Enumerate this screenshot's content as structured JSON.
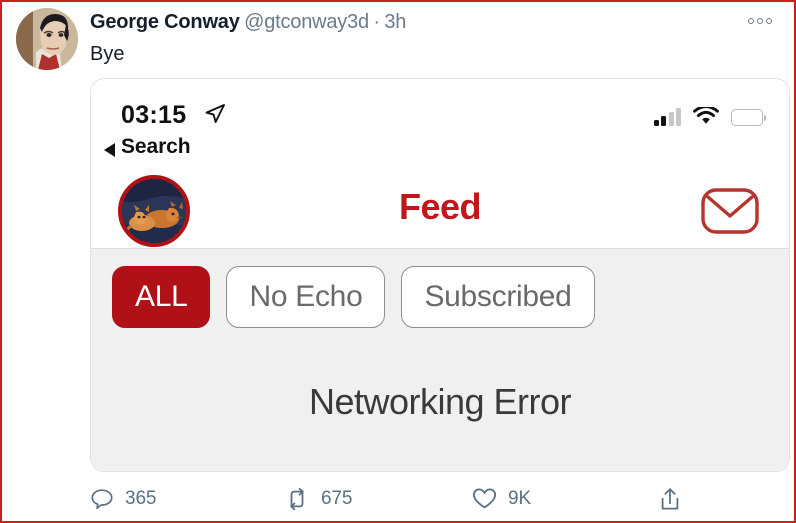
{
  "tweet": {
    "display_name": "George Conway",
    "handle": "@gtconway3d",
    "separator": "·",
    "timestamp": "3h",
    "text": "Bye",
    "overflow_label": "More",
    "avatar_alt": "author-avatar"
  },
  "actions": {
    "reply": {
      "icon": "reply-icon",
      "count": "365"
    },
    "retweet": {
      "icon": "retweet-icon",
      "count": "675"
    },
    "like": {
      "icon": "heart-icon",
      "count": "9K"
    },
    "share": {
      "icon": "share-icon",
      "count": ""
    }
  },
  "phone": {
    "status_bar": {
      "time": "03:15",
      "location_icon": "location-arrow-icon",
      "signal_icon": "signal-bars-icon",
      "wifi_icon": "wifi-icon",
      "battery_icon": "battery-icon"
    },
    "back_label": "Search",
    "nav": {
      "title": "Feed",
      "avatar_alt": "profile-avatar",
      "mail_icon": "envelope-icon"
    },
    "filters": [
      {
        "label": "ALL",
        "active": true
      },
      {
        "label": "No Echo",
        "active": false
      },
      {
        "label": "Subscribed",
        "active": false
      }
    ],
    "status_message": "Networking Error"
  },
  "colors": {
    "frame_border": "#c9211e",
    "brand_red": "#c1171c",
    "chip_active_bg": "#b01116",
    "avatar_ring": "#b01116",
    "muted_text": "#5b7083",
    "body_bg": "#f0f0f0"
  }
}
